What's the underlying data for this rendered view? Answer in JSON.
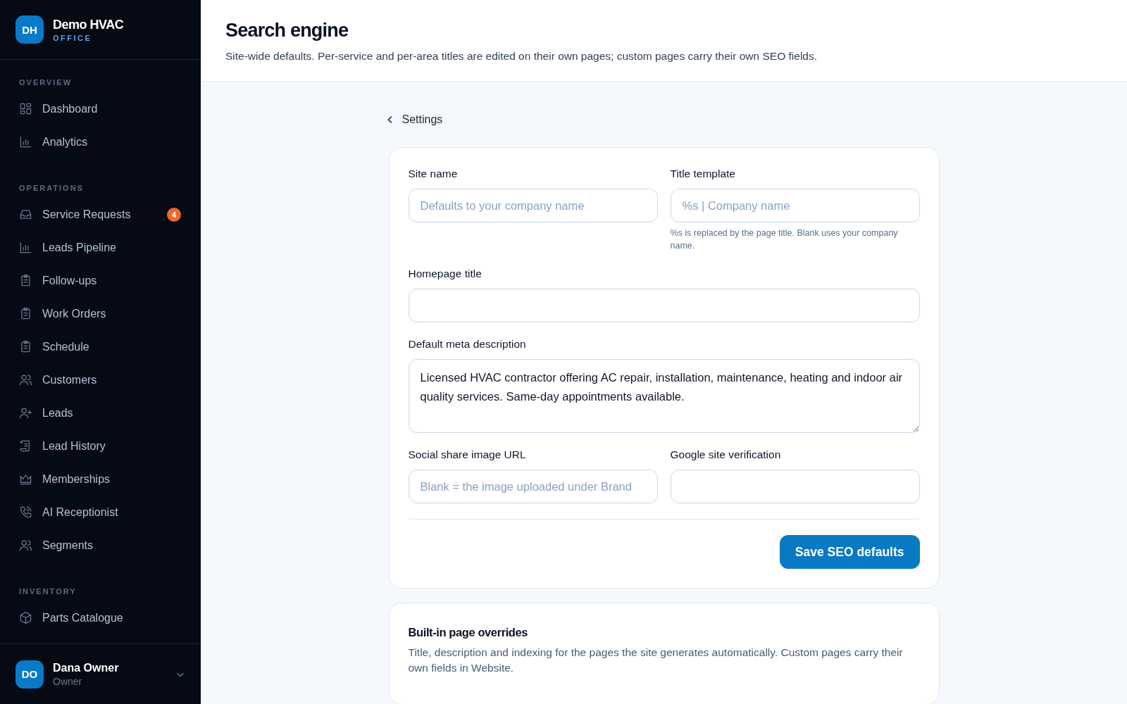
{
  "brand": {
    "initials": "DH",
    "name": "Demo HVAC",
    "subtitle": "OFFICE"
  },
  "sidebar": {
    "sections": [
      {
        "title": "OVERVIEW",
        "items": [
          {
            "label": "Dashboard"
          },
          {
            "label": "Analytics"
          }
        ]
      },
      {
        "title": "OPERATIONS",
        "items": [
          {
            "label": "Service Requests",
            "badge": "4"
          },
          {
            "label": "Leads Pipeline"
          },
          {
            "label": "Follow-ups"
          },
          {
            "label": "Work Orders"
          },
          {
            "label": "Schedule"
          },
          {
            "label": "Customers"
          },
          {
            "label": "Leads"
          },
          {
            "label": "Lead History"
          },
          {
            "label": "Memberships"
          },
          {
            "label": "AI Receptionist"
          },
          {
            "label": "Segments"
          }
        ]
      },
      {
        "title": "INVENTORY",
        "items": [
          {
            "label": "Parts Catalogue"
          }
        ]
      }
    ]
  },
  "user": {
    "initials": "DO",
    "name": "Dana Owner",
    "role": "Owner"
  },
  "header": {
    "title": "Search engine",
    "subtitle": "Site-wide defaults. Per-service and per-area titles are edited on their own pages; custom pages carry their own SEO fields."
  },
  "back_link": "Settings",
  "seo_form": {
    "rows": [
      [
        {
          "kind": "input",
          "label": "Site name",
          "placeholder": "Defaults to your company name"
        },
        {
          "kind": "input",
          "label": "Title template",
          "placeholder": "%s | Company name",
          "hint": "%s is replaced by the page title. Blank uses your company name."
        }
      ],
      [
        {
          "kind": "input",
          "label": "Homepage title"
        }
      ],
      [
        {
          "kind": "textarea",
          "label": "Default meta description",
          "value": "Licensed HVAC contractor offering AC repair, installation, maintenance, heating and indoor air quality services. Same-day appointments available."
        }
      ],
      [
        {
          "kind": "input",
          "label": "Social share image URL",
          "placeholder": "Blank = the image uploaded under Brand"
        },
        {
          "kind": "input",
          "label": "Google site verification"
        }
      ]
    ],
    "save_button": "Save SEO defaults"
  },
  "overrides": {
    "title": "Built-in page overrides",
    "description": "Title, description and indexing for the pages the site generates automatically. Custom pages carry their own fields in Website."
  }
}
